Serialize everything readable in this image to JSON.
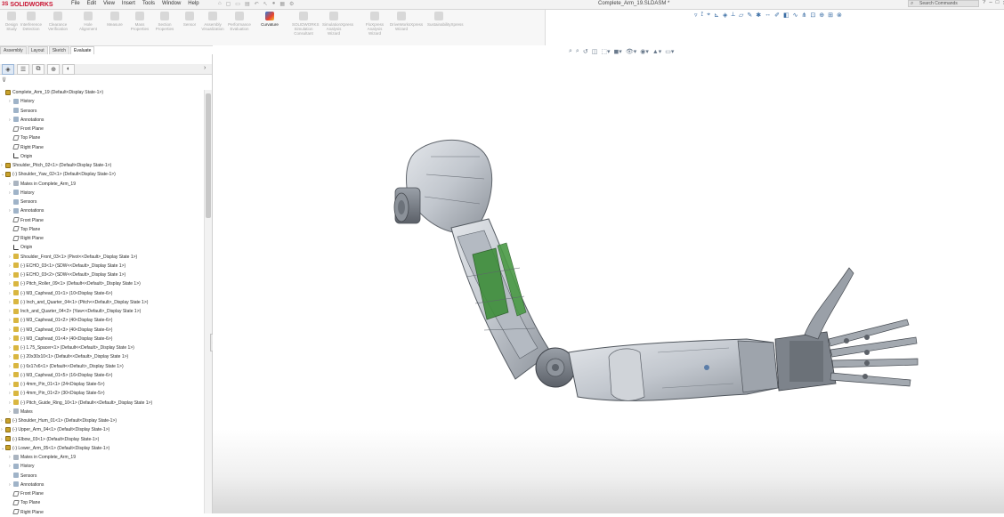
{
  "app": {
    "logo_text": "SOLIDWORKS",
    "logo_mark": "3S",
    "document_title": "Complete_Arm_19.SLDASM *",
    "search_placeholder": "Search Commands",
    "window_controls": [
      "?",
      "–",
      "□",
      "✕"
    ]
  },
  "menus": [
    "File",
    "Edit",
    "View",
    "Insert",
    "Tools",
    "Window",
    "Help"
  ],
  "ribbon": {
    "buttons": [
      {
        "label": "Design Study",
        "active": false
      },
      {
        "label": "Interference Detection",
        "active": false
      },
      {
        "label": "Clearance Verification",
        "active": false
      },
      {
        "label": "Hole Alignment",
        "active": false
      },
      {
        "label": "Measure",
        "active": false
      },
      {
        "label": "Mass Properties",
        "active": false
      },
      {
        "label": "Section Properties",
        "active": false
      },
      {
        "label": "Sensor",
        "active": false
      },
      {
        "label": "Assembly Visualization",
        "active": false
      },
      {
        "label": "Performance Evaluation",
        "active": false
      },
      {
        "label": "Curvature",
        "active": true
      },
      {
        "label": "SOLIDWORKS Simulation Consultant",
        "active": false
      },
      {
        "label": "SimulationXpress Analysis Wizard",
        "active": false
      },
      {
        "label": "FloXpress Analysis Wizard",
        "active": false
      },
      {
        "label": "DriveWorksXpress Wizard",
        "active": false
      },
      {
        "label": "SustainabilityXpress",
        "active": false
      }
    ]
  },
  "cm_tabs": [
    {
      "label": "Assembly",
      "active": false
    },
    {
      "label": "Layout",
      "active": false
    },
    {
      "label": "Sketch",
      "active": false
    },
    {
      "label": "Evaluate",
      "active": true
    }
  ],
  "tree": {
    "rows": [
      {
        "indent": 0,
        "expander": "",
        "icon": "assy",
        "text": "Complete_Arm_19  (Default<Display State-1>)"
      },
      {
        "indent": 1,
        "expander": "›",
        "icon": "folder",
        "text": "History"
      },
      {
        "indent": 1,
        "expander": "",
        "icon": "folder",
        "text": "Sensors"
      },
      {
        "indent": 1,
        "expander": "›",
        "icon": "folder",
        "text": "Annotations"
      },
      {
        "indent": 1,
        "expander": "",
        "icon": "plane",
        "text": "Front Plane"
      },
      {
        "indent": 1,
        "expander": "",
        "icon": "plane",
        "text": "Top Plane"
      },
      {
        "indent": 1,
        "expander": "",
        "icon": "plane",
        "text": "Right Plane"
      },
      {
        "indent": 1,
        "expander": "",
        "icon": "origin",
        "text": "Origin"
      },
      {
        "indent": 0,
        "expander": "›",
        "icon": "assy",
        "text": "Shoulder_Pitch_02<1> (Default<Display State-1>)"
      },
      {
        "indent": 0,
        "expander": "⌄",
        "icon": "assy",
        "text": "(-) Shoulder_Yaw_02<1> (Default<Display State-1>)"
      },
      {
        "indent": 1,
        "expander": "›",
        "icon": "mates",
        "text": "Mates in Complete_Arm_19"
      },
      {
        "indent": 1,
        "expander": "›",
        "icon": "folder",
        "text": "History"
      },
      {
        "indent": 1,
        "expander": "",
        "icon": "folder",
        "text": "Sensors"
      },
      {
        "indent": 1,
        "expander": "›",
        "icon": "folder",
        "text": "Annotations"
      },
      {
        "indent": 1,
        "expander": "",
        "icon": "plane",
        "text": "Front Plane"
      },
      {
        "indent": 1,
        "expander": "",
        "icon": "plane",
        "text": "Top Plane"
      },
      {
        "indent": 1,
        "expander": "",
        "icon": "plane",
        "text": "Right Plane"
      },
      {
        "indent": 1,
        "expander": "",
        "icon": "origin",
        "text": "Origin"
      },
      {
        "indent": 1,
        "expander": "›",
        "icon": "part",
        "text": "Shoulder_Front_03<1> (Pivot<<Default>_Display State 1>)"
      },
      {
        "indent": 1,
        "expander": "›",
        "icon": "part",
        "text": "(-) ECHO_03<1> (SDW<<Default>_Display State 1>)"
      },
      {
        "indent": 1,
        "expander": "›",
        "icon": "part",
        "text": "(-) ECHO_03<2> (SDW<<Default>_Display State 1>)"
      },
      {
        "indent": 1,
        "expander": "›",
        "icon": "part",
        "text": "(-) Pitch_Roller_09<1> (Default<<Default>_Display State 1>)"
      },
      {
        "indent": 1,
        "expander": "›",
        "icon": "part",
        "text": "(-) M3_Caphead_01<1> (10<Display State-6>)"
      },
      {
        "indent": 1,
        "expander": "›",
        "icon": "part",
        "text": "(-) Inch_and_Quarter_04<1> (Pitch<<Default>_Display State 1>)"
      },
      {
        "indent": 1,
        "expander": "›",
        "icon": "part",
        "text": "Inch_and_Quarter_04<2> (Yaw<<Default>_Display State 1>)"
      },
      {
        "indent": 1,
        "expander": "›",
        "icon": "part",
        "text": "(-) M3_Caphead_01<2> (40<Display State-6>)"
      },
      {
        "indent": 1,
        "expander": "›",
        "icon": "part",
        "text": "(-) M3_Caphead_01<3> (40<Display State-6>)"
      },
      {
        "indent": 1,
        "expander": "›",
        "icon": "part",
        "text": "(-) M3_Caphead_01<4> (40<Display State-6>)"
      },
      {
        "indent": 1,
        "expander": "›",
        "icon": "part",
        "text": "(-) 1.75_Spacer<1> (Default<<Default>_Display State 1>)"
      },
      {
        "indent": 1,
        "expander": "›",
        "icon": "part",
        "text": "(-) 20x30x10<1> (Default<<Default>_Display State 1>)"
      },
      {
        "indent": 1,
        "expander": "›",
        "icon": "part",
        "text": "(-) 6x17x6<1> (Default<<Default>_Display State 1>)"
      },
      {
        "indent": 1,
        "expander": "›",
        "icon": "part",
        "text": "(-) M3_Caphead_01<5> (16<Display State-6>)"
      },
      {
        "indent": 1,
        "expander": "›",
        "icon": "part",
        "text": "(-) 4mm_Pin_01<1> (24<Display State-5>)"
      },
      {
        "indent": 1,
        "expander": "›",
        "icon": "part",
        "text": "(-) 4mm_Pin_01<2> (30<Display State-5>)"
      },
      {
        "indent": 1,
        "expander": "›",
        "icon": "part",
        "text": "(-) Pitch_Guide_Ring_10<1> (Default<<Default>_Display State 1>)"
      },
      {
        "indent": 1,
        "expander": "›",
        "icon": "mates",
        "text": "Mates"
      },
      {
        "indent": 0,
        "expander": "›",
        "icon": "assy",
        "text": "(-) Shoulder_Hum_01<1> (Default<Display State-1>)"
      },
      {
        "indent": 0,
        "expander": "›",
        "icon": "assy",
        "text": "(-) Upper_Arm_04<1> (Default<Display State-1>)"
      },
      {
        "indent": 0,
        "expander": "›",
        "icon": "assy",
        "text": "(-) Elbow_03<1> (Default<Display State-1>)"
      },
      {
        "indent": 0,
        "expander": "⌄",
        "icon": "assy",
        "text": "(-) Lower_Arm_05<1> (Default<Display State-1>)"
      },
      {
        "indent": 1,
        "expander": "›",
        "icon": "mates",
        "text": "Mates in Complete_Arm_19"
      },
      {
        "indent": 1,
        "expander": "›",
        "icon": "folder",
        "text": "History"
      },
      {
        "indent": 1,
        "expander": "",
        "icon": "folder",
        "text": "Sensors"
      },
      {
        "indent": 1,
        "expander": "›",
        "icon": "folder",
        "text": "Annotations"
      },
      {
        "indent": 1,
        "expander": "",
        "icon": "plane",
        "text": "Front Plane"
      },
      {
        "indent": 1,
        "expander": "",
        "icon": "plane",
        "text": "Top Plane"
      },
      {
        "indent": 1,
        "expander": "",
        "icon": "plane",
        "text": "Right Plane"
      }
    ]
  },
  "colors": {
    "brand_red": "#c8102e",
    "arm_shell": "#c8ccd3",
    "pcb_green": "#3e8e3a"
  }
}
